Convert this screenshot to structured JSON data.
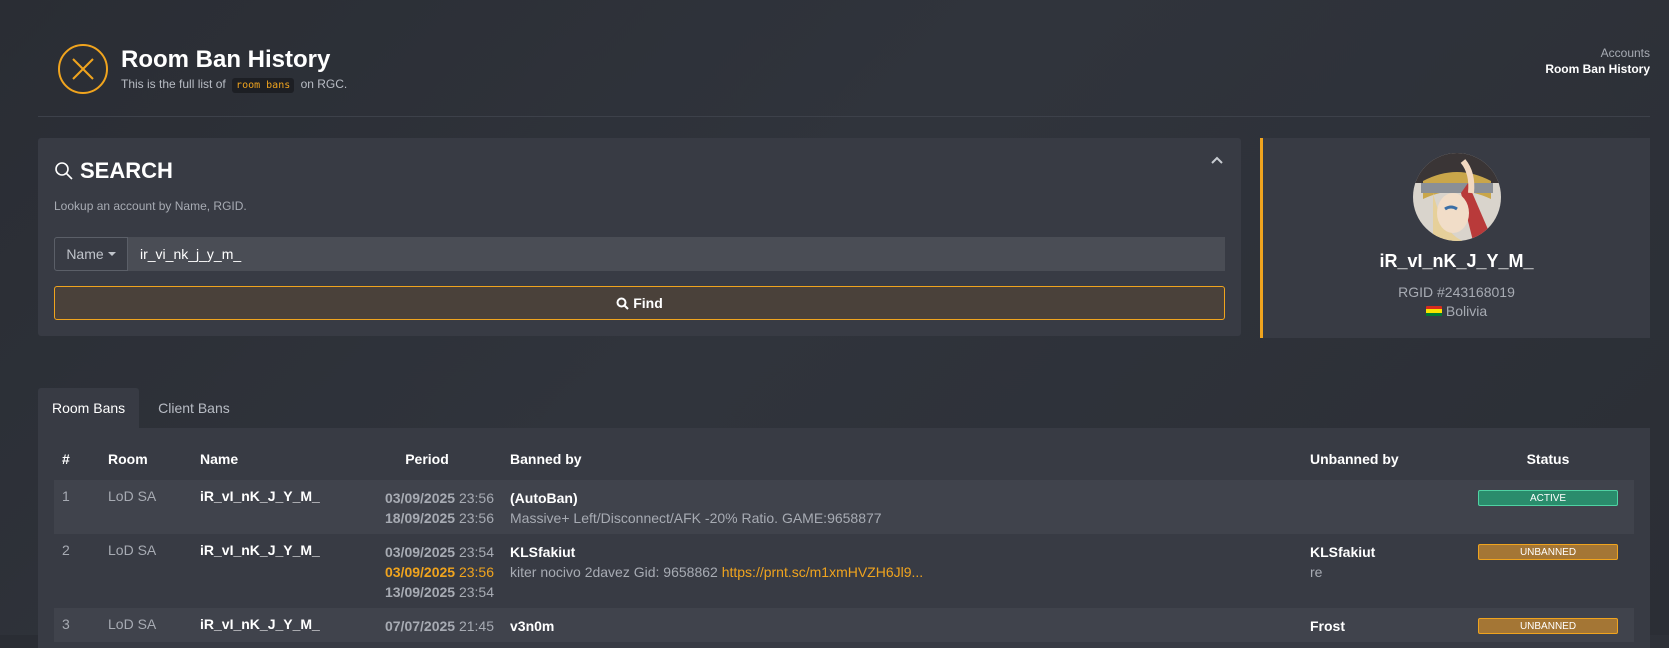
{
  "header": {
    "title": "Room Ban History",
    "subtitle_pre": "This is the full list of",
    "subtitle_code": "room bans",
    "subtitle_post": "on RGC.",
    "breadcrumb": [
      "Accounts",
      "Room Ban History"
    ]
  },
  "search": {
    "title": "SEARCH",
    "description": "Lookup an account by Name, RGID.",
    "type_label": "Name",
    "query": "ir_vi_nk_j_y_m_",
    "find_label": "Find"
  },
  "profile": {
    "name": "iR_vI_nK_J_Y_M_",
    "rgid": "RGID #243168019",
    "country": "Bolivia"
  },
  "tabs": [
    "Room Bans",
    "Client Bans"
  ],
  "table": {
    "headers": [
      "#",
      "Room",
      "Name",
      "Period",
      "Banned by",
      "Unbanned by",
      "Status"
    ],
    "rows": [
      {
        "num": "1",
        "room": "LoD SA",
        "name": "iR_vI_nK_J_Y_M_",
        "period": [
          {
            "date": "03/09/2025",
            "time": "23:56",
            "highlight": false
          },
          {
            "date": "18/09/2025",
            "time": "23:56",
            "highlight": false
          }
        ],
        "banned_by": "(AutoBan)",
        "reason": "Massive+ Left/Disconnect/AFK -20% Ratio. GAME:9658877",
        "reason_link": "",
        "unbanned_by": "",
        "unban_reason": "",
        "status": "ACTIVE"
      },
      {
        "num": "2",
        "room": "LoD SA",
        "name": "iR_vI_nK_J_Y_M_",
        "period": [
          {
            "date": "03/09/2025",
            "time": "23:54",
            "highlight": false
          },
          {
            "date": "03/09/2025",
            "time": "23:56",
            "highlight": true
          },
          {
            "date": "13/09/2025",
            "time": "23:54",
            "highlight": false
          }
        ],
        "banned_by": "KLSfakiut",
        "reason": "kiter nocivo 2davez Gid: 9658862",
        "reason_link": "https://prnt.sc/m1xmHVZH6Jl9...",
        "unbanned_by": "KLSfakiut",
        "unban_reason": "re",
        "status": "UNBANNED"
      },
      {
        "num": "3",
        "room": "LoD SA",
        "name": "iR_vI_nK_J_Y_M_",
        "period": [
          {
            "date": "07/07/2025",
            "time": "21:45",
            "highlight": false
          }
        ],
        "banned_by": "v3n0m",
        "reason": "",
        "reason_link": "",
        "unbanned_by": "Frost",
        "unban_reason": "",
        "status": "UNBANNED"
      }
    ]
  },
  "colors": {
    "accent": "#f0a41e",
    "active": "#2a8c6c",
    "unbanned": "#a47635"
  }
}
